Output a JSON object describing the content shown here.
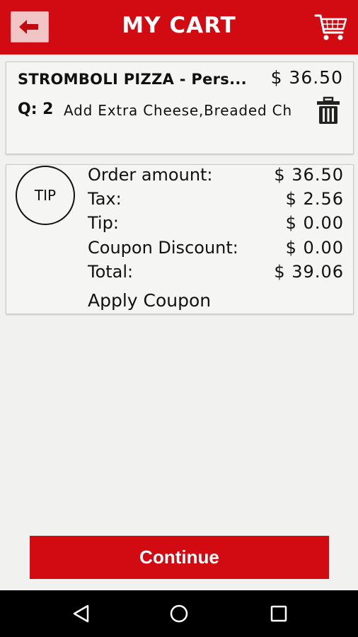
{
  "header": {
    "title": "MY CART",
    "back_icon": "back-arrow-icon",
    "cart_icon": "shopping-cart-icon",
    "color": "#d20a11"
  },
  "cart_item": {
    "name": "STROMBOLI PIZZA - Pers...",
    "price": "$ 36.50",
    "qty_label": "Q: 2",
    "options": "Add Extra Cheese,Breaded Ch",
    "delete_icon": "trash-icon"
  },
  "summary": {
    "tip_label": "TIP",
    "rows": [
      {
        "label": "Order amount:",
        "value": "$ 36.50"
      },
      {
        "label": "Tax:",
        "value": "$ 2.56"
      },
      {
        "label": "Tip:",
        "value": "$ 0.00"
      },
      {
        "label": "Coupon Discount:",
        "value": "$ 0.00"
      },
      {
        "label": "Total:",
        "value": "$ 39.06"
      }
    ],
    "apply_coupon": "Apply Coupon"
  },
  "actions": {
    "continue_label": "Continue"
  },
  "system_nav": {
    "icons": [
      "back-triangle-icon",
      "home-circle-icon",
      "recents-square-icon"
    ]
  }
}
